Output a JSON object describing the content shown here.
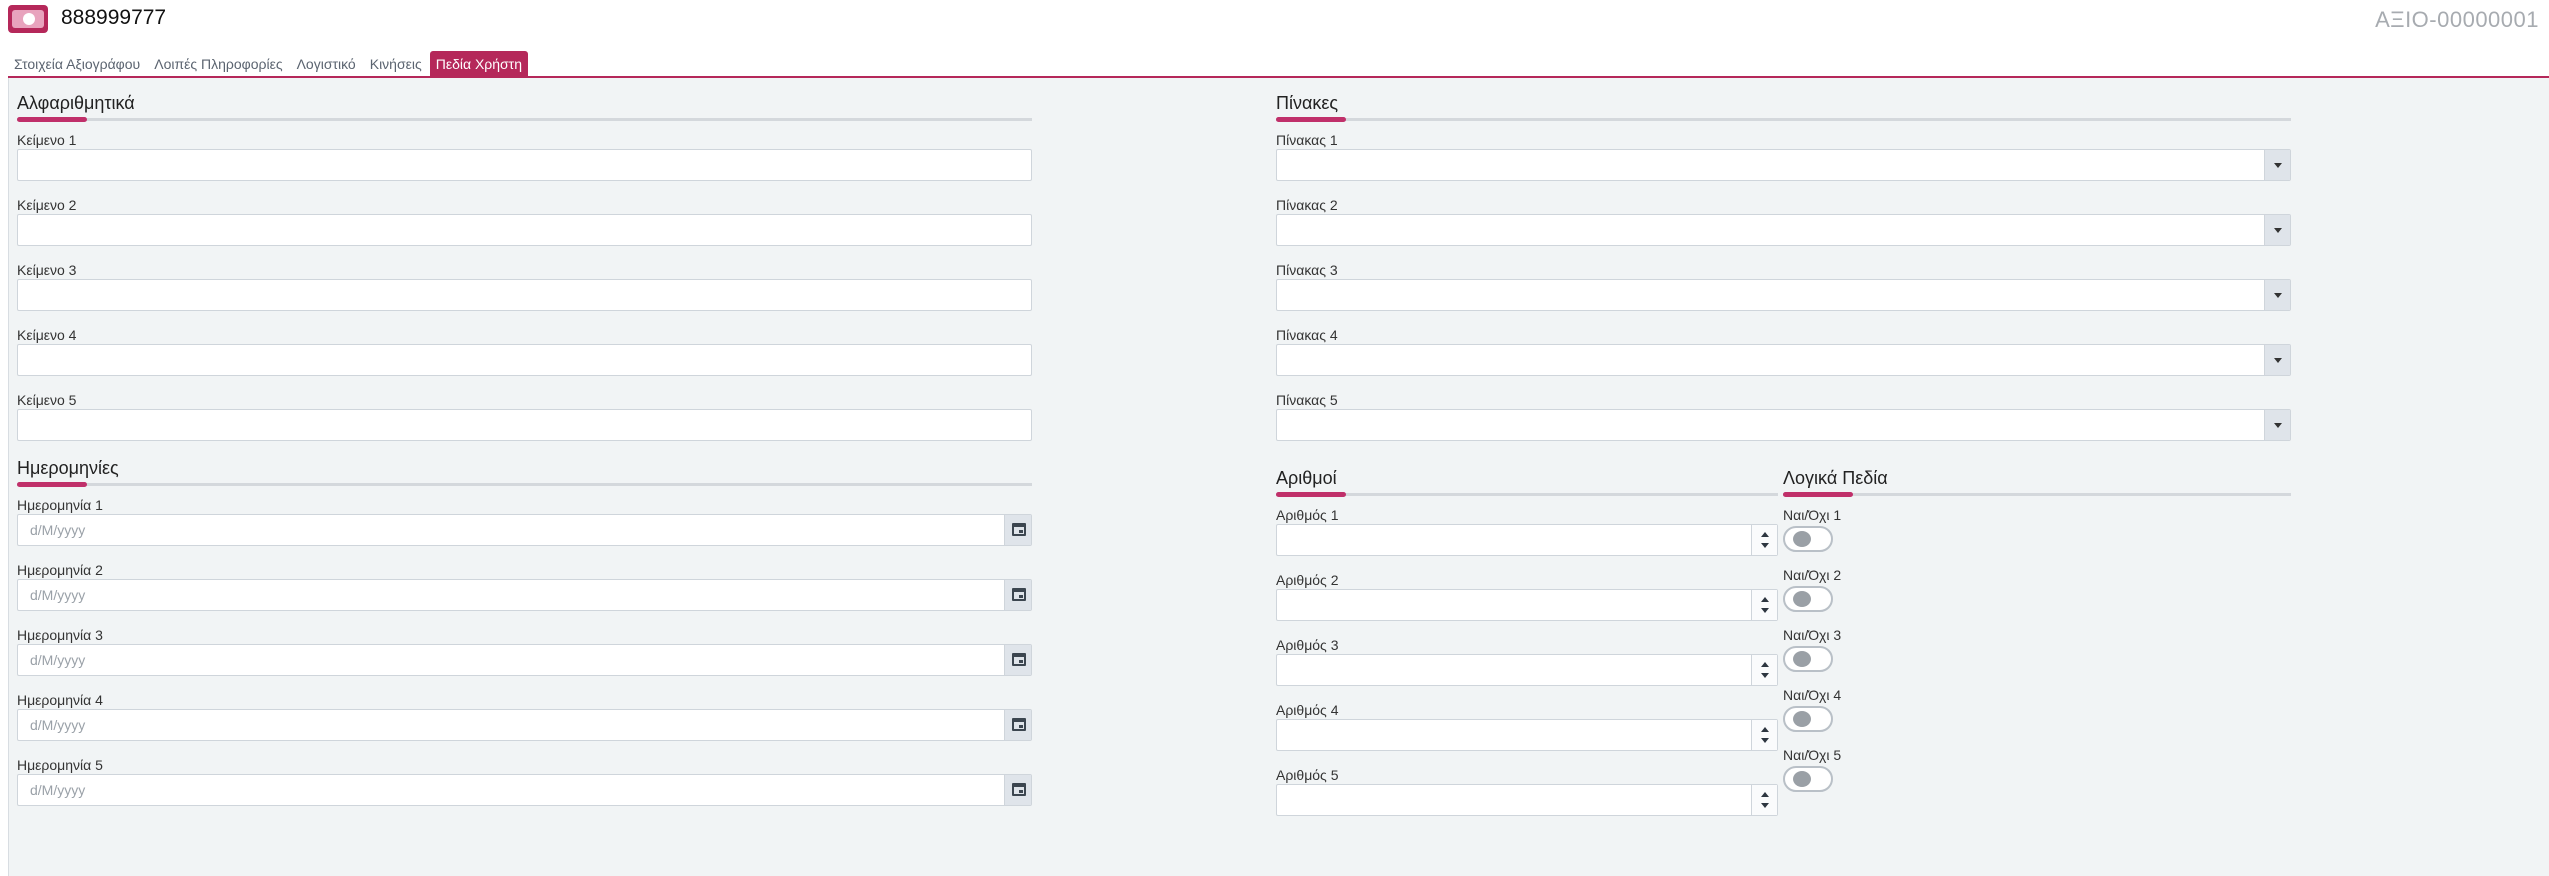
{
  "header": {
    "title": "888999777",
    "doc_code": "ΑΞΙΟ-00000001"
  },
  "tabs": [
    {
      "label": "Στοιχεία Αξιογράφου"
    },
    {
      "label": "Λοιπές Πληροφορίες"
    },
    {
      "label": "Λογιστικό"
    },
    {
      "label": "Κινήσεις"
    },
    {
      "label": "Πεδία Χρήστη",
      "active": true
    }
  ],
  "colors": {
    "accent": "#b5285a",
    "panel_bg": "#f1f4f5"
  },
  "alpha": {
    "title": "Αλφαριθμητικά",
    "fields": [
      {
        "label": "Κείμενο 1",
        "value": ""
      },
      {
        "label": "Κείμενο 2",
        "value": ""
      },
      {
        "label": "Κείμενο 3",
        "value": ""
      },
      {
        "label": "Κείμενο 4",
        "value": ""
      },
      {
        "label": "Κείμενο 5",
        "value": ""
      }
    ]
  },
  "dates": {
    "title": "Ημερομηνίες",
    "placeholder": "d/M/yyyy",
    "fields": [
      {
        "label": "Ημερομηνία 1"
      },
      {
        "label": "Ημερομηνία 2"
      },
      {
        "label": "Ημερομηνία 3"
      },
      {
        "label": "Ημερομηνία 4"
      },
      {
        "label": "Ημερομηνία 5"
      }
    ]
  },
  "tables": {
    "title": "Πίνακες",
    "fields": [
      {
        "label": "Πίνακας 1",
        "value": ""
      },
      {
        "label": "Πίνακας 2",
        "value": ""
      },
      {
        "label": "Πίνακας 3",
        "value": ""
      },
      {
        "label": "Πίνακας 4",
        "value": ""
      },
      {
        "label": "Πίνακας 5",
        "value": ""
      }
    ]
  },
  "numbers": {
    "title": "Αριθμοί",
    "fields": [
      {
        "label": "Αριθμός 1",
        "value": ""
      },
      {
        "label": "Αριθμός 2",
        "value": ""
      },
      {
        "label": "Αριθμός 3",
        "value": ""
      },
      {
        "label": "Αριθμός 4",
        "value": ""
      },
      {
        "label": "Αριθμός 5",
        "value": ""
      }
    ]
  },
  "logical": {
    "title": "Λογικά Πεδία",
    "fields": [
      {
        "label": "Ναι/Όχι 1",
        "checked": false
      },
      {
        "label": "Ναι/Όχι 2",
        "checked": false
      },
      {
        "label": "Ναι/Όχι 3",
        "checked": false
      },
      {
        "label": "Ναι/Όχι 4",
        "checked": false
      },
      {
        "label": "Ναι/Όχι 5",
        "checked": false
      }
    ]
  }
}
